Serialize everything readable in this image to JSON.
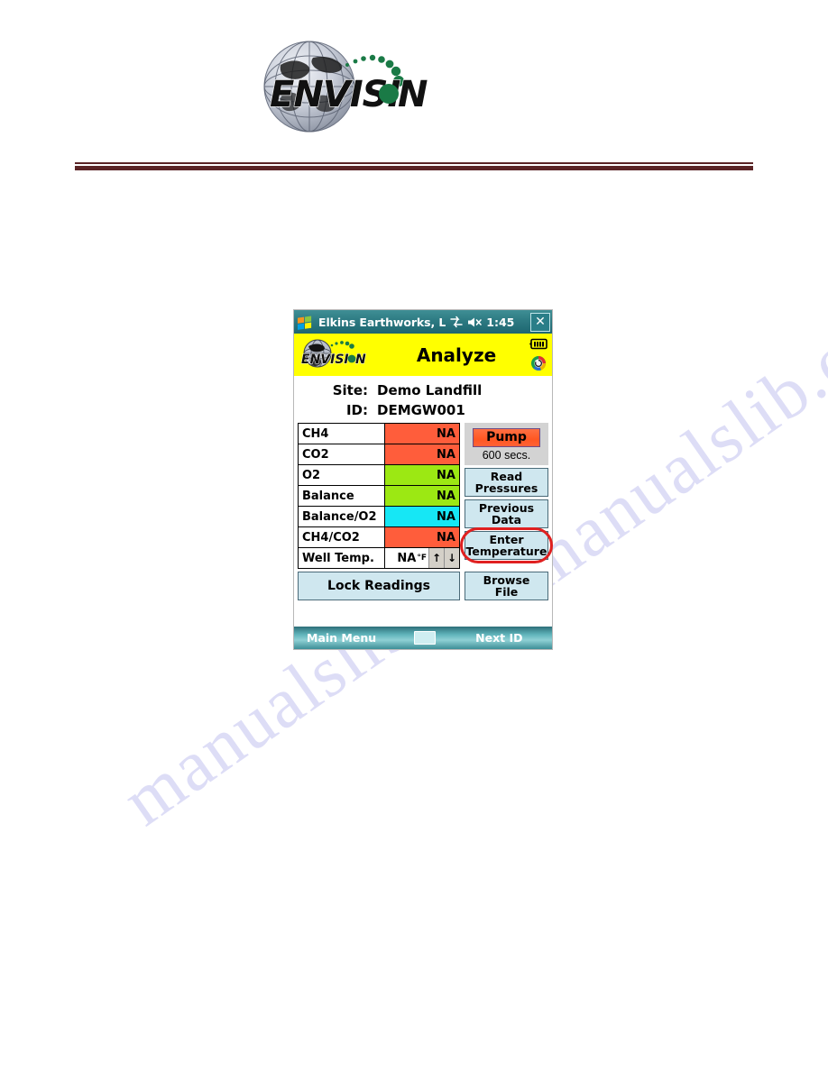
{
  "page": {
    "brand_logo": "envision-globe-logo",
    "brand_name": "ENVISION",
    "watermark_text_1": "manualslib.com",
    "watermark_text_2": "manualslib.com"
  },
  "device": {
    "titlebar": {
      "start_icon": "windows-start-flag-icon",
      "title": "Elkins Earthworks, L",
      "connectivity_icon": "connectivity-icon",
      "volume_icon": "volume-muted-icon",
      "time": "1:45",
      "close_label": "✕"
    },
    "appheader": {
      "logo": "envision-logo",
      "title": "Analyze",
      "battery_icon": "battery-icon",
      "sync_icon": "sync-icon"
    },
    "info": {
      "site_label": "Site:",
      "site_value": "Demo Landfill",
      "id_label": "ID:",
      "id_value": "DEMGW001"
    },
    "readings": {
      "rows": [
        {
          "label": "CH4",
          "value": "NA",
          "color": "#ff5d3b"
        },
        {
          "label": "CO2",
          "value": "NA",
          "color": "#ff5d3b"
        },
        {
          "label": "O2",
          "value": "NA",
          "color": "#9ce813"
        },
        {
          "label": "Balance",
          "value": "NA",
          "color": "#9ce813"
        },
        {
          "label": "Balance/O2",
          "value": "NA",
          "color": "#16e7f5"
        },
        {
          "label": "CH4/CO2",
          "value": "NA",
          "color": "#ff5d3b"
        }
      ],
      "well_temp": {
        "label": "Well Temp.",
        "value": "NA",
        "unit": "°F",
        "up_icon": "arrow-up-icon",
        "down_icon": "arrow-down-icon"
      }
    },
    "buttons": {
      "pump": "Pump",
      "pump_timer": "600 secs.",
      "read_pressures": "Read\nPressures",
      "read_pressures_line1": "Read",
      "read_pressures_line2": "Pressures",
      "previous_data_line1": "Previous",
      "previous_data_line2": "Data",
      "enter_temperature_line1": "Enter",
      "enter_temperature_line2": "Temperature",
      "browse_file_line1": "Browse",
      "browse_file_line2": "File",
      "lock_readings": "Lock Readings"
    },
    "taskbar": {
      "main_menu": "Main Menu",
      "keyboard_icon": "keyboard-icon",
      "next_id": "Next ID"
    },
    "annotation": {
      "highlight_target": "enter-temperature-button",
      "highlight_color": "#e02020"
    },
    "colors": {
      "header_yellow": "#ffff00",
      "titlebar_teal": "#2d7a82",
      "button_blue": "#cfe7ef",
      "pump_orange": "#ff5722",
      "rule_maroon": "#5b2526"
    }
  }
}
